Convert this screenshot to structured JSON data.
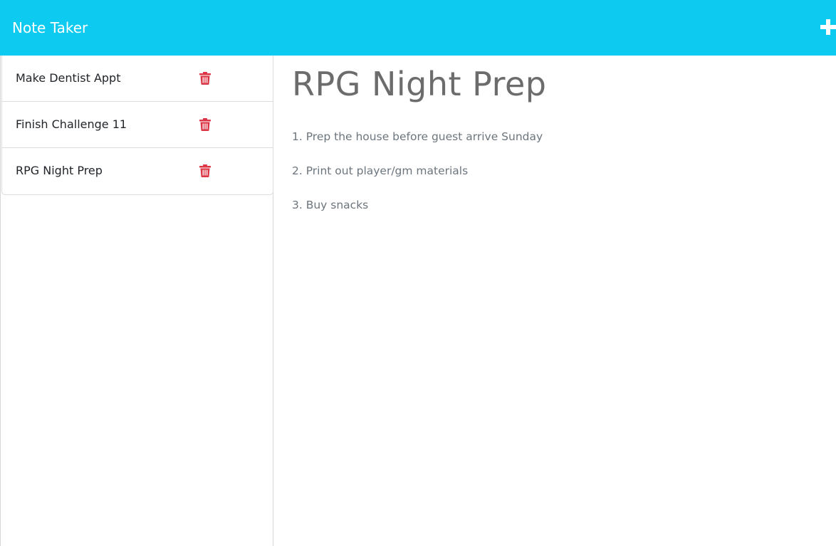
{
  "navbar": {
    "brand": "Note Taker",
    "add_icon": "plus-icon"
  },
  "colors": {
    "navbar_bg": "#0dcaf0",
    "trash": "#dc3545",
    "heading": "#6c6c6c"
  },
  "sidebar": {
    "notes": [
      {
        "title": "Make Dentist Appt",
        "icon": "trash-icon"
      },
      {
        "title": "Finish Challenge 11",
        "icon": "trash-icon"
      },
      {
        "title": "RPG Night Prep",
        "icon": "trash-icon"
      }
    ]
  },
  "main": {
    "note_title": "RPG Night Prep",
    "note_text_lines": [
      "1. Prep the house before guest arrive Sunday",
      "2. Print out player/gm materials",
      "3. Buy snacks"
    ]
  }
}
